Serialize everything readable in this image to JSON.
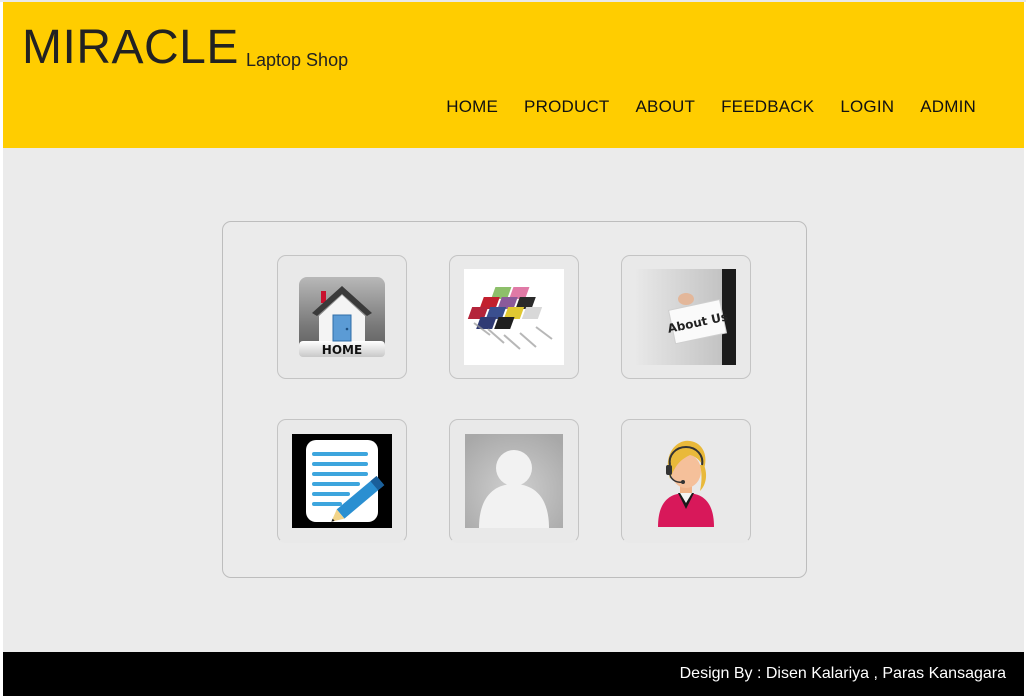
{
  "header": {
    "brand": "MIRACLE",
    "tagline": "Laptop Shop",
    "background": "#ffcd00"
  },
  "nav": {
    "items": [
      {
        "label": "HOME"
      },
      {
        "label": "PRODUCT"
      },
      {
        "label": "ABOUT"
      },
      {
        "label": "FEEDBACK"
      },
      {
        "label": "LOGIN"
      },
      {
        "label": "ADMIN"
      }
    ]
  },
  "tiles": {
    "home_icon_text": "HOME",
    "about_icon_text": "About Us",
    "icons": [
      "home-icon",
      "laptops-image",
      "about-us-image",
      "feedback-icon",
      "user-placeholder-icon",
      "support-agent-icon"
    ]
  },
  "footer": {
    "credit": "Design By : Disen Kalariya , Paras Kansagara",
    "background": "#000000"
  }
}
